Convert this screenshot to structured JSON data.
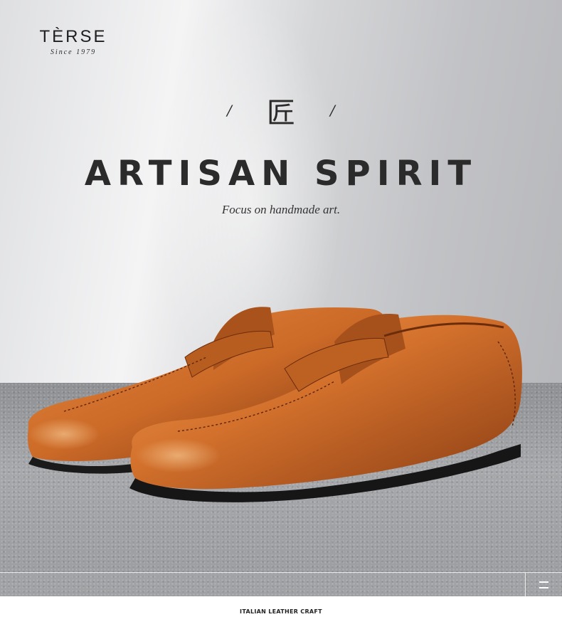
{
  "brand": {
    "name": "TÈRSE",
    "since": "Since 1979"
  },
  "hero": {
    "slash_left": "/",
    "cn_char": "匠",
    "slash_right": "/",
    "headline": "ARTISAN SPIRIT",
    "tagline": "Focus on handmade art."
  },
  "product": {
    "image": "leather-penny-loafers",
    "color": "#c8642a"
  },
  "nav": {
    "menu_icon": "menu-icon"
  },
  "footer": {
    "caption": "ITALIAN LEATHER CRAFT"
  }
}
